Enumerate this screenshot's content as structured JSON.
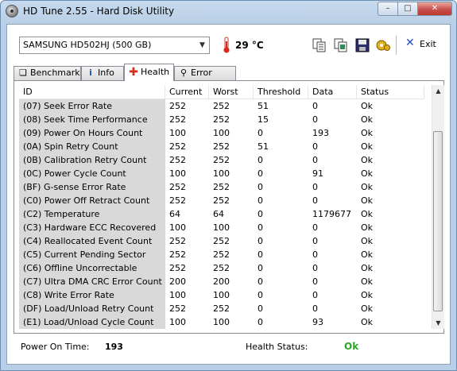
{
  "window": {
    "title": "HD Tune 2.55 - Hard Disk Utility"
  },
  "toolbar": {
    "drive": "SAMSUNG HD502HJ (500 GB)",
    "temperature": "29 °C",
    "exit_label": "Exit",
    "icons": [
      "copy-info-icon",
      "copy-screenshot-icon",
      "save-icon",
      "options-icon"
    ]
  },
  "tabs": [
    {
      "label": "Benchmark",
      "icon": "benchmark-icon"
    },
    {
      "label": "Info",
      "icon": "info-icon"
    },
    {
      "label": "Health",
      "icon": "health-icon",
      "active": true
    },
    {
      "label": "Error Scan",
      "icon": "error-scan-icon"
    }
  ],
  "table": {
    "columns": [
      "ID",
      "Current",
      "Worst",
      "Threshold",
      "Data",
      "Status"
    ],
    "rows": [
      [
        "(07) Seek Error Rate",
        "252",
        "252",
        "51",
        "0",
        "Ok"
      ],
      [
        "(08) Seek Time Performance",
        "252",
        "252",
        "15",
        "0",
        "Ok"
      ],
      [
        "(09) Power On Hours Count",
        "100",
        "100",
        "0",
        "193",
        "Ok"
      ],
      [
        "(0A) Spin Retry Count",
        "252",
        "252",
        "51",
        "0",
        "Ok"
      ],
      [
        "(0B) Calibration Retry Count",
        "252",
        "252",
        "0",
        "0",
        "Ok"
      ],
      [
        "(0C) Power Cycle Count",
        "100",
        "100",
        "0",
        "91",
        "Ok"
      ],
      [
        "(BF) G-sense Error Rate",
        "252",
        "252",
        "0",
        "0",
        "Ok"
      ],
      [
        "(C0) Power Off Retract Count",
        "252",
        "252",
        "0",
        "0",
        "Ok"
      ],
      [
        "(C2) Temperature",
        "64",
        "64",
        "0",
        "1179677",
        "Ok"
      ],
      [
        "(C3) Hardware ECC Recovered",
        "100",
        "100",
        "0",
        "0",
        "Ok"
      ],
      [
        "(C4) Reallocated Event Count",
        "252",
        "252",
        "0",
        "0",
        "Ok"
      ],
      [
        "(C5) Current Pending Sector",
        "252",
        "252",
        "0",
        "0",
        "Ok"
      ],
      [
        "(C6) Offline Uncorrectable",
        "252",
        "252",
        "0",
        "0",
        "Ok"
      ],
      [
        "(C7) Ultra DMA CRC Error Count",
        "200",
        "200",
        "0",
        "0",
        "Ok"
      ],
      [
        "(C8) Write Error Rate",
        "100",
        "100",
        "0",
        "0",
        "Ok"
      ],
      [
        "(DF) Load/Unload Retry Count",
        "252",
        "252",
        "0",
        "0",
        "Ok"
      ],
      [
        "(E1) Load/Unload Cycle Count",
        "100",
        "100",
        "0",
        "93",
        "Ok"
      ]
    ]
  },
  "footer": {
    "power_on_label": "Power On Time:",
    "power_on_value": "193",
    "health_label": "Health Status:",
    "health_value": "Ok"
  },
  "colors": {
    "health_ok": "#2aa52a",
    "id_column_bg": "#d9d9d9",
    "exit_x": "#1f4fbf"
  }
}
